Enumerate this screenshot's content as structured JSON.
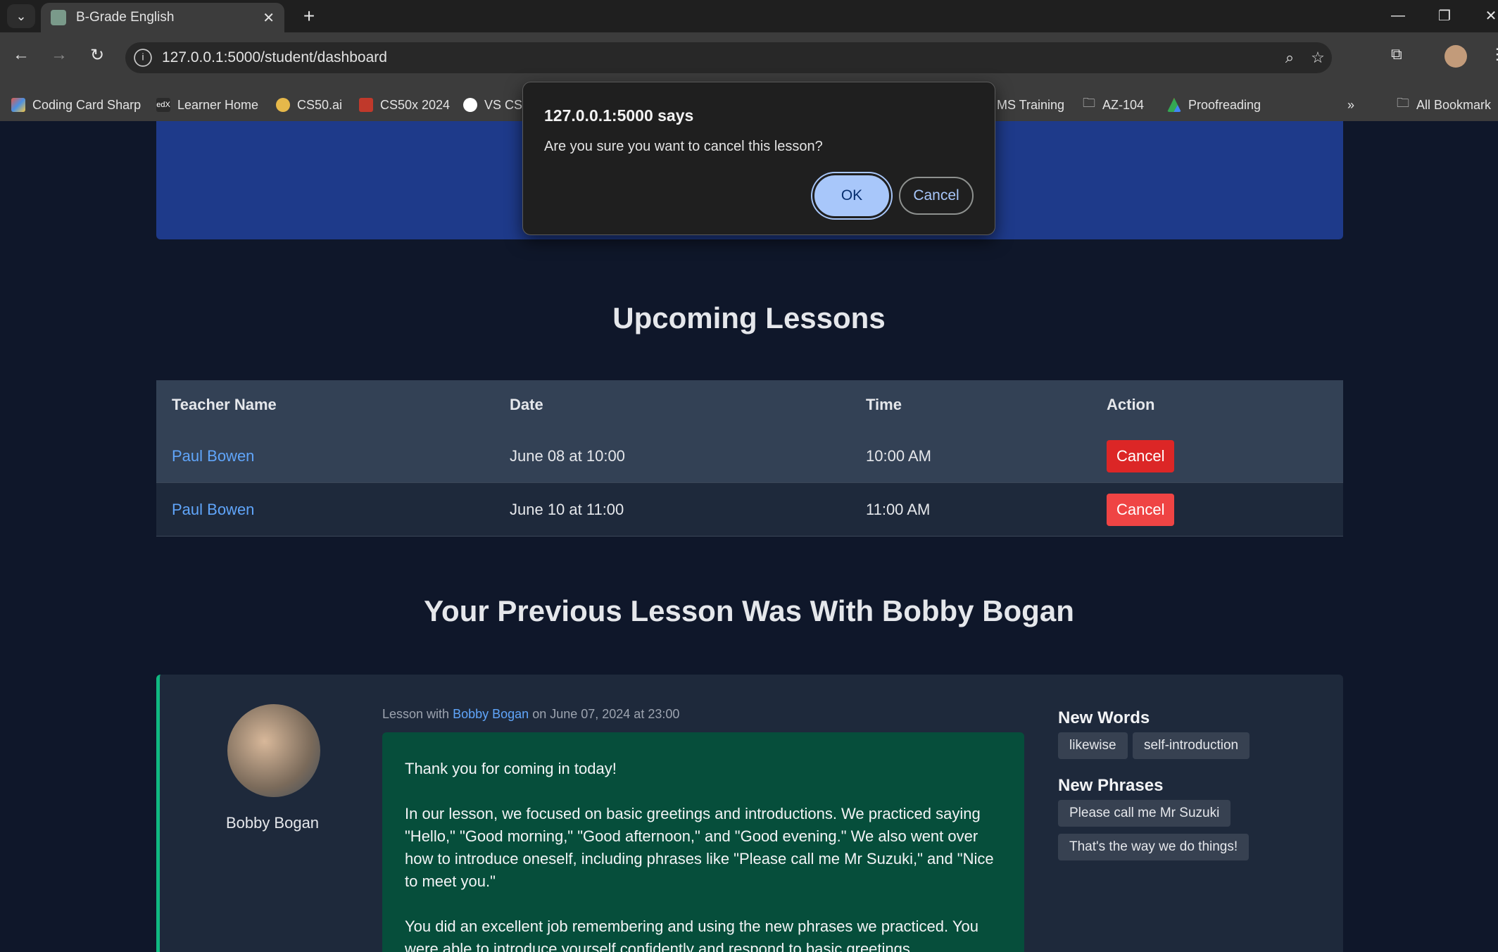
{
  "browser": {
    "tab_title": "B-Grade English",
    "url": "127.0.0.1:5000/student/dashboard",
    "bookmarks": [
      {
        "label": "Coding Card Sharp",
        "color": "#e05a4a"
      },
      {
        "label": "Learner Home",
        "color": "#ffffff"
      },
      {
        "label": "CS50.ai",
        "color": "#e6b84a"
      },
      {
        "label": "CS50x 2024",
        "color": "#c0392b"
      },
      {
        "label": "VS CS",
        "color": "#ffffff"
      },
      {
        "label": "MS Training",
        "color": ""
      },
      {
        "label": "AZ-104",
        "color": ""
      },
      {
        "label": "Proofreading",
        "color": "#34a853"
      }
    ],
    "all_bookmarks_label": "All Bookmark"
  },
  "dialog": {
    "title": "127.0.0.1:5000 says",
    "message": "Are you sure you want to cancel this lesson?",
    "ok_label": "OK",
    "cancel_label": "Cancel"
  },
  "upcoming": {
    "title": "Upcoming Lessons",
    "headers": [
      "Teacher Name",
      "Date",
      "Time",
      "Action"
    ],
    "rows": [
      {
        "teacher": "Paul Bowen",
        "date": "June 08 at 10:00",
        "time": "10:00 AM",
        "action": "Cancel"
      },
      {
        "teacher": "Paul Bowen",
        "date": "June 10 at 11:00",
        "time": "11:00 AM",
        "action": "Cancel"
      }
    ]
  },
  "previous": {
    "title": "Your Previous Lesson Was With Bobby Bogan",
    "teacher_name": "Bobby Bogan",
    "meta_prefix": "Lesson with",
    "meta_teacher": "Bobby Bogan",
    "meta_suffix": "on June 07, 2024 at 23:00",
    "feedback": [
      "Thank you for coming in today!",
      "In our lesson, we focused on basic greetings and introductions. We practiced saying \"Hello,\" \"Good morning,\" \"Good afternoon,\" and \"Good evening.\" We also went over how to introduce oneself, including phrases like \"Please call me Mr Suzuki,\" and \"Nice to meet you.\"",
      "You did an excellent job remembering and using the new phrases we practiced. You were able to introduce yourself confidently and respond to basic greetings appropriately. Your"
    ],
    "new_words_title": "New Words",
    "new_words": [
      "likewise",
      "self-introduction"
    ],
    "new_phrases_title": "New Phrases",
    "new_phrases": [
      "Please call me Mr Suzuki",
      "That's the way we do things!"
    ]
  }
}
